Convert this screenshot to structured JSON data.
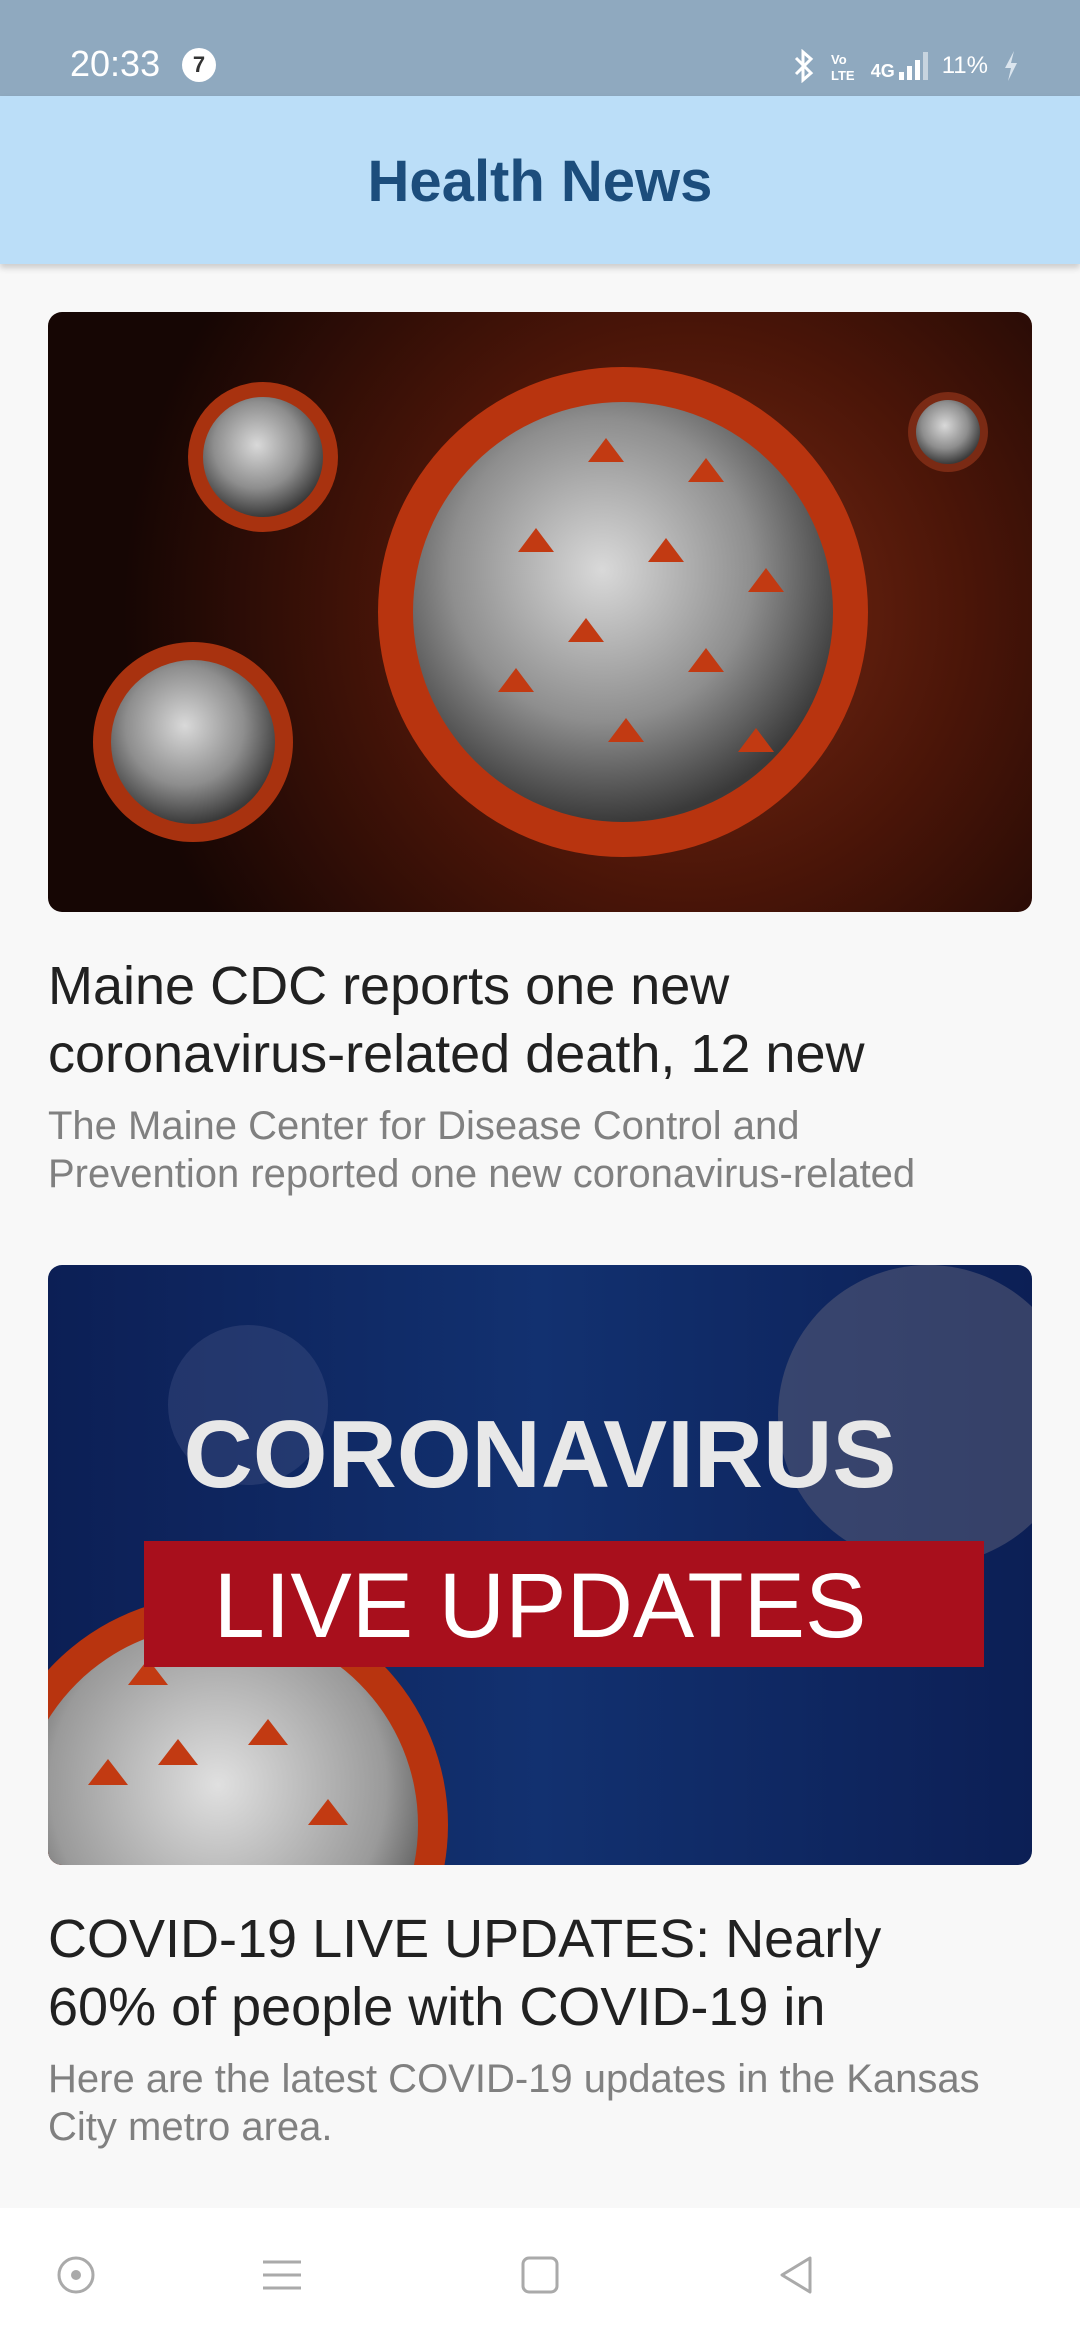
{
  "status_bar": {
    "time": "20:33",
    "notification_count": "7",
    "battery_percent": "11%",
    "icons": [
      "bluetooth-icon",
      "volte-icon",
      "4g-signal-icon",
      "signal-bars-icon",
      "battery-charging-icon"
    ]
  },
  "app_bar": {
    "title": "Health News",
    "background_color": "#bbdef8",
    "title_color": "#1c4d7c"
  },
  "articles": [
    {
      "image_description": "coronavirus-particles-image",
      "headline_line1": "Maine CDC reports one new",
      "headline_line2": "coronavirus-related death, 12 new",
      "snippet_line1": "The Maine Center for Disease Control and",
      "snippet_line2": "Prevention reported one new coronavirus-related"
    },
    {
      "image_description": "coronavirus-live-updates-image",
      "image_text_line1": "CORONAVIRUS",
      "image_text_line2": "LIVE UPDATES",
      "headline_line1": "COVID-19 LIVE UPDATES: Nearly",
      "headline_line2": "60% of people with COVID-19 in",
      "snippet_line1": "Here are the latest COVID-19 updates in the Kansas",
      "snippet_line2": "City metro area."
    }
  ],
  "nav_bar": {
    "buttons": [
      "assistant-dot-icon",
      "menu-lines-icon",
      "home-square-icon",
      "back-triangle-icon"
    ]
  }
}
